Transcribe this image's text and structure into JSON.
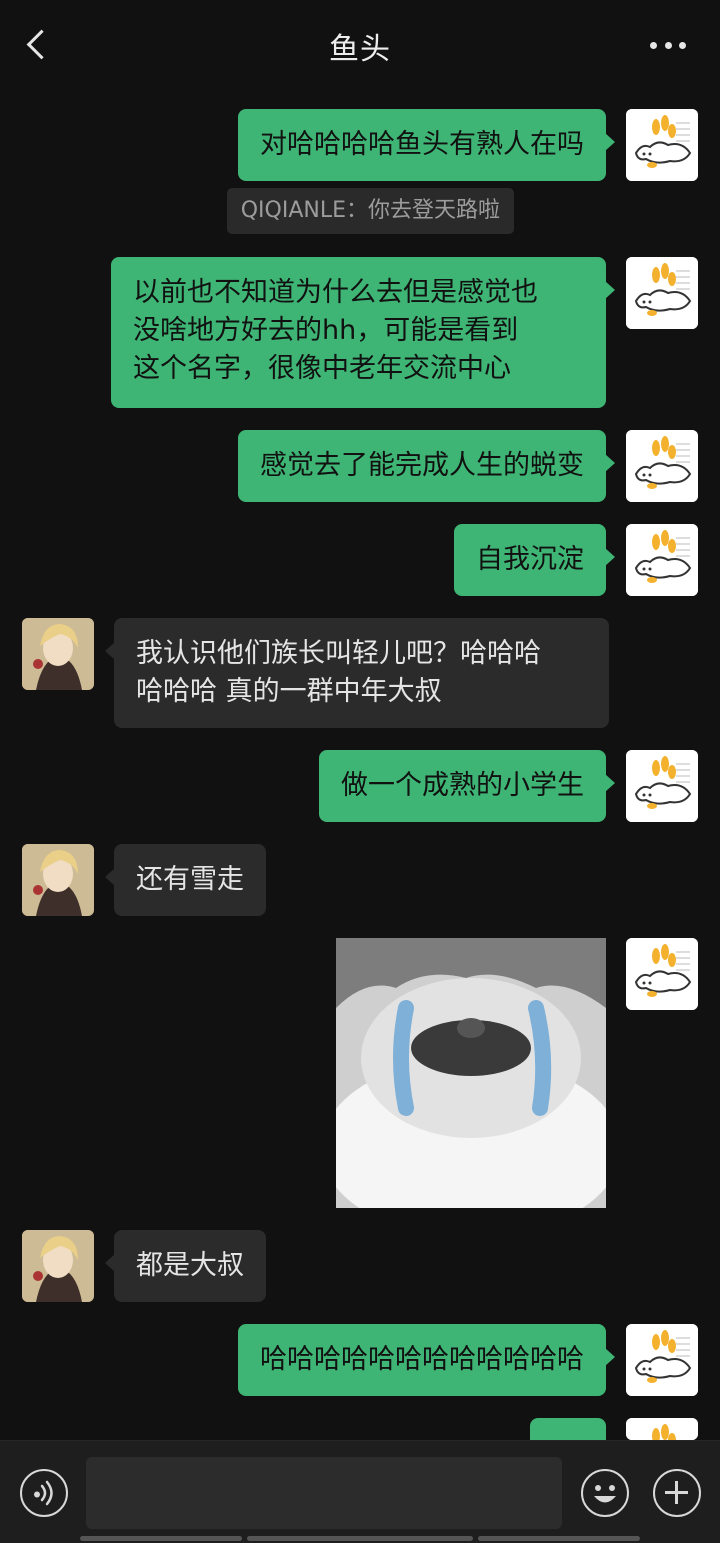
{
  "header": {
    "title": "鱼头",
    "back_icon": "chevron-left-icon",
    "more_icon": "more-dots-icon"
  },
  "messages": [
    {
      "side": "sent",
      "text": "对哈哈哈哈鱼头有熟人在吗",
      "quote": "QIQIANLE：你去登天路啦"
    },
    {
      "side": "sent",
      "lines": [
        "以前也不知道为什么去但是感觉也",
        "没啥地方好去的hh，可能是看到",
        "这个名字，很像中老年交流中心"
      ]
    },
    {
      "side": "sent",
      "text": "感觉去了能完成人生的蜕变"
    },
    {
      "side": "sent",
      "text": "自我沉淀"
    },
    {
      "side": "received",
      "lines": [
        "我认识他们族长叫轻儿吧？哈哈哈",
        "哈哈哈 真的一群中年大叔"
      ]
    },
    {
      "side": "sent",
      "text": "做一个成熟的小学生"
    },
    {
      "side": "received",
      "text": "还有雪走"
    },
    {
      "side": "sent",
      "type": "sticker",
      "sticker": "crying-cat-sticker"
    },
    {
      "side": "received",
      "text": "都是大叔"
    },
    {
      "side": "sent",
      "text": "哈哈哈哈哈哈哈哈哈哈哈哈"
    }
  ],
  "footer": {
    "voice_icon": "voice-icon",
    "emoji_icon": "emoji-icon",
    "plus_icon": "plus-icon"
  },
  "colors": {
    "sent_bubble": "#3eb575",
    "received_bubble": "#2b2b2b",
    "background": "#111111"
  }
}
